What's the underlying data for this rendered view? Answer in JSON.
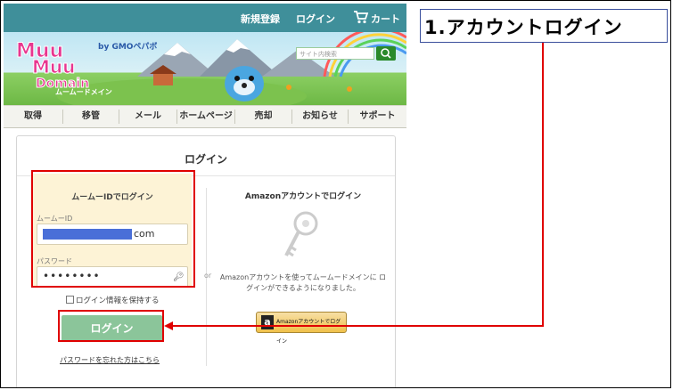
{
  "topbar": {
    "signup": "新規登録",
    "login": "ログイン",
    "cart": "カート"
  },
  "banner": {
    "logo_lines": [
      "Muu",
      "Muu",
      "Domain"
    ],
    "logo_sub": "ムームードメイン",
    "gmo": "by GMOペパボ",
    "search_placeholder": "サイト内検索",
    "search_button": "Q"
  },
  "nav": {
    "items": [
      {
        "label": "取得"
      },
      {
        "label": "移管"
      },
      {
        "label": "メール"
      },
      {
        "label": "ホームページ"
      },
      {
        "label": "売却"
      },
      {
        "label": "お知らせ"
      },
      {
        "label": "サポート"
      }
    ]
  },
  "login_card": {
    "title": "ログイン",
    "muumuu": {
      "title": "ムームーIDでログイン",
      "id_label": "ムームーID",
      "id_value_suffix": "com",
      "password_label": "パスワード",
      "password_value": "••••••••",
      "remember_label": "ログイン情報を保持する",
      "login_button": "ログイン",
      "forgot_link": "パスワードを忘れた方はこちら"
    },
    "or": "or",
    "amazon": {
      "title": "Amazonアカウントでログイン",
      "description": "Amazonアカウントを使ってムームードメインに ログインができるようになりました。",
      "button_label": "Amazonアカウントでログイン"
    }
  },
  "annotation": {
    "callout": "1.アカウントログイン",
    "color": "#e00000"
  }
}
